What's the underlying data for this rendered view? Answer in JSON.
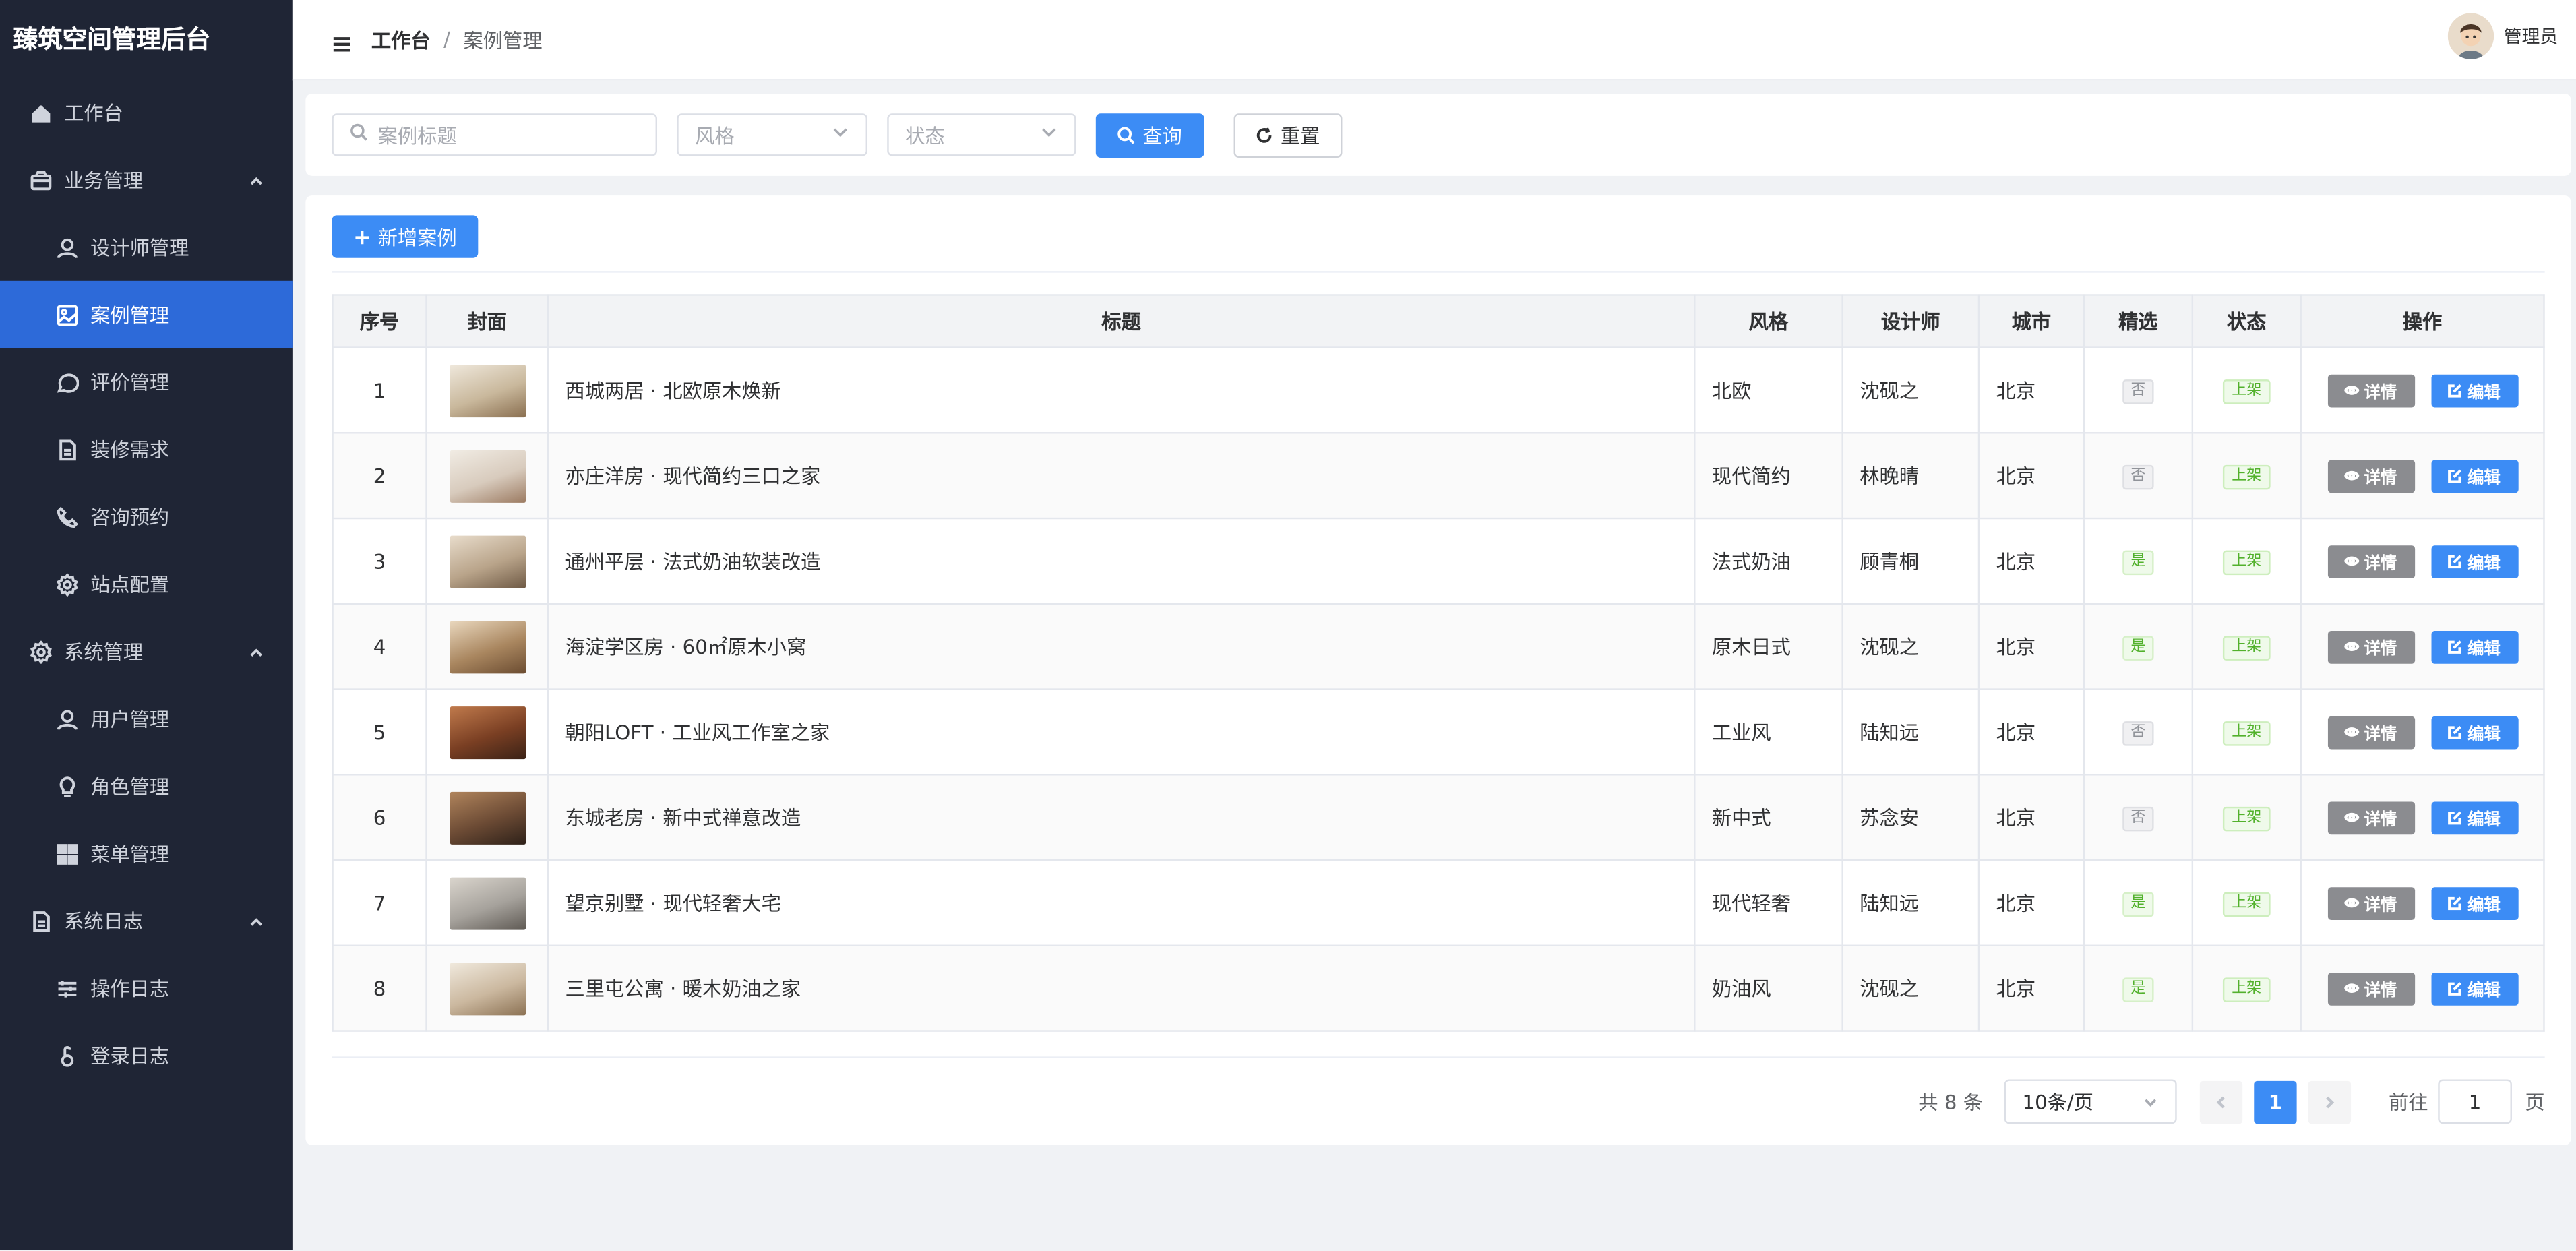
{
  "app": {
    "title": "臻筑空间管理后台"
  },
  "sidebar": {
    "items": [
      {
        "label": "工作台",
        "icon": "home-icon"
      },
      {
        "label": "业务管理",
        "icon": "box-icon"
      },
      {
        "label": "设计师管理",
        "icon": "user-icon"
      },
      {
        "label": "案例管理",
        "icon": "picture-icon"
      },
      {
        "label": "评价管理",
        "icon": "chat-icon"
      },
      {
        "label": "装修需求",
        "icon": "document-icon"
      },
      {
        "label": "咨询预约",
        "icon": "phone-icon"
      },
      {
        "label": "站点配置",
        "icon": "gear-icon"
      },
      {
        "label": "系统管理",
        "icon": "gear-icon"
      },
      {
        "label": "用户管理",
        "icon": "user-icon"
      },
      {
        "label": "角色管理",
        "icon": "bulb-icon"
      },
      {
        "label": "菜单管理",
        "icon": "grid-icon"
      },
      {
        "label": "系统日志",
        "icon": "document-icon"
      },
      {
        "label": "操作日志",
        "icon": "sliders-icon"
      },
      {
        "label": "登录日志",
        "icon": "lock-icon"
      }
    ]
  },
  "header": {
    "breadcrumb": {
      "home": "工作台",
      "separator": "/",
      "current": "案例管理"
    },
    "user": {
      "name": "管理员"
    }
  },
  "search": {
    "title_placeholder": "案例标题",
    "style_placeholder": "风格",
    "status_placeholder": "状态",
    "query_label": "查询",
    "reset_label": "重置"
  },
  "toolbar": {
    "add_label": "新增案例"
  },
  "table": {
    "headers": [
      "序号",
      "封面",
      "标题",
      "风格",
      "设计师",
      "城市",
      "精选",
      "状态",
      "操作"
    ],
    "detail_label": "详情",
    "edit_label": "编辑",
    "rows": [
      {
        "no": "1",
        "title": "西城两居 · 北欧原木焕新",
        "style": "北欧",
        "designer": "沈砚之",
        "city": "北京",
        "featured": "否",
        "status": "上架"
      },
      {
        "no": "2",
        "title": "亦庄洋房 · 现代简约三口之家",
        "style": "现代简约",
        "designer": "林晚晴",
        "city": "北京",
        "featured": "否",
        "status": "上架"
      },
      {
        "no": "3",
        "title": "通州平层 · 法式奶油软装改造",
        "style": "法式奶油",
        "designer": "顾青桐",
        "city": "北京",
        "featured": "是",
        "status": "上架"
      },
      {
        "no": "4",
        "title": "海淀学区房 · 60㎡原木小窝",
        "style": "原木日式",
        "designer": "沈砚之",
        "city": "北京",
        "featured": "是",
        "status": "上架"
      },
      {
        "no": "5",
        "title": "朝阳LOFT · 工业风工作室之家",
        "style": "工业风",
        "designer": "陆知远",
        "city": "北京",
        "featured": "否",
        "status": "上架"
      },
      {
        "no": "6",
        "title": "东城老房 · 新中式禅意改造",
        "style": "新中式",
        "designer": "苏念安",
        "city": "北京",
        "featured": "否",
        "status": "上架"
      },
      {
        "no": "7",
        "title": "望京别墅 · 现代轻奢大宅",
        "style": "现代轻奢",
        "designer": "陆知远",
        "city": "北京",
        "featured": "是",
        "status": "上架"
      },
      {
        "no": "8",
        "title": "三里屯公寓 · 暖木奶油之家",
        "style": "奶油风",
        "designer": "沈砚之",
        "city": "北京",
        "featured": "是",
        "status": "上架"
      }
    ]
  },
  "pagination": {
    "total": "共 8 条",
    "page_size": "10条/页",
    "current": "1",
    "goto_prefix": "前往",
    "goto_value": "1",
    "goto_suffix": "页"
  },
  "colors": {
    "sidebar_bg": "#1f2535",
    "active_menu": "#2d6ad9",
    "primary": "#3c8cf5",
    "success": "#52b12c"
  }
}
